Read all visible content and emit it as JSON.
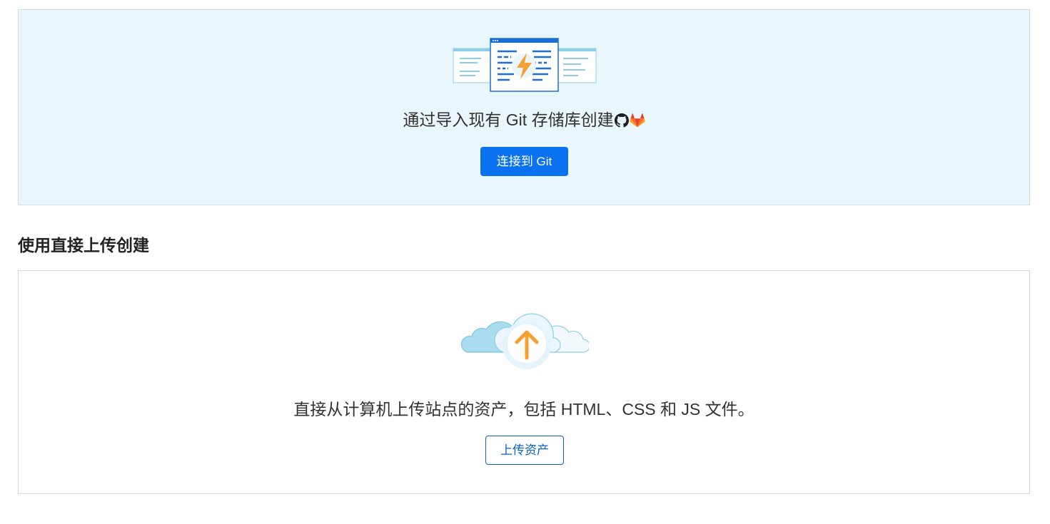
{
  "git_section": {
    "title": "通过导入现有 Git 存储库创建",
    "github_icon": "github-icon",
    "gitlab_icon": "gitlab-icon",
    "connect_button_label": "连接到 Git",
    "illustration_icon": "code-editor-lightning-icon"
  },
  "upload_section": {
    "heading": "使用直接上传创建",
    "description": "直接从计算机上传站点的资产，包括 HTML、CSS 和 JS 文件。",
    "upload_button_label": "上传资产",
    "illustration_icon": "cloud-upload-icon"
  },
  "colors": {
    "primary": "#0a72f0",
    "git_card_bg": "#e9f6fb",
    "accent_orange": "#f6a033"
  }
}
